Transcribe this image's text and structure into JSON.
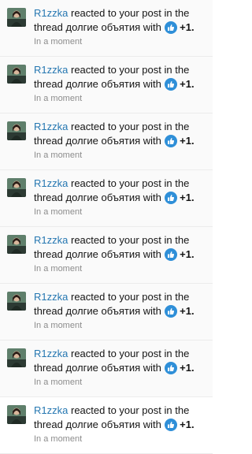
{
  "notifications": [
    {
      "username": "R1zzka",
      "action": "reacted to your post in the thread",
      "thread": "долгие объятия",
      "with_word": "with",
      "reaction_icon": "thumbs-up-icon",
      "reaction_label": "+1.",
      "time": "In a moment"
    },
    {
      "username": "R1zzka",
      "action": "reacted to your post in the thread",
      "thread": "долгие объятия",
      "with_word": "with",
      "reaction_icon": "thumbs-up-icon",
      "reaction_label": "+1.",
      "time": "In a moment"
    },
    {
      "username": "R1zzka",
      "action": "reacted to your post in the thread",
      "thread": "долгие объятия",
      "with_word": "with",
      "reaction_icon": "thumbs-up-icon",
      "reaction_label": "+1.",
      "time": "In a moment"
    },
    {
      "username": "R1zzka",
      "action": "reacted to your post in the thread",
      "thread": "долгие объятия",
      "with_word": "with",
      "reaction_icon": "thumbs-up-icon",
      "reaction_label": "+1.",
      "time": "In a moment"
    },
    {
      "username": "R1zzka",
      "action": "reacted to your post in the thread",
      "thread": "долгие объятия",
      "with_word": "with",
      "reaction_icon": "thumbs-up-icon",
      "reaction_label": "+1.",
      "time": "In a moment"
    },
    {
      "username": "R1zzka",
      "action": "reacted to your post in the thread",
      "thread": "долгие объятия",
      "with_word": "with",
      "reaction_icon": "thumbs-up-icon",
      "reaction_label": "+1.",
      "time": "In a moment"
    },
    {
      "username": "R1zzka",
      "action": "reacted to your post in the thread",
      "thread": "долгие объятия",
      "with_word": "with",
      "reaction_icon": "thumbs-up-icon",
      "reaction_label": "+1.",
      "time": "In a moment"
    },
    {
      "username": "R1zzka",
      "action": "reacted to your post in the thread",
      "thread": "долгие объятия",
      "with_word": "with",
      "reaction_icon": "thumbs-up-icon",
      "reaction_label": "+1.",
      "time": "In a moment"
    }
  ],
  "colors": {
    "username": "#2577b1",
    "text": "#141414",
    "time": "#8c8c8c",
    "reaction_icon": "#2f8fd8"
  }
}
